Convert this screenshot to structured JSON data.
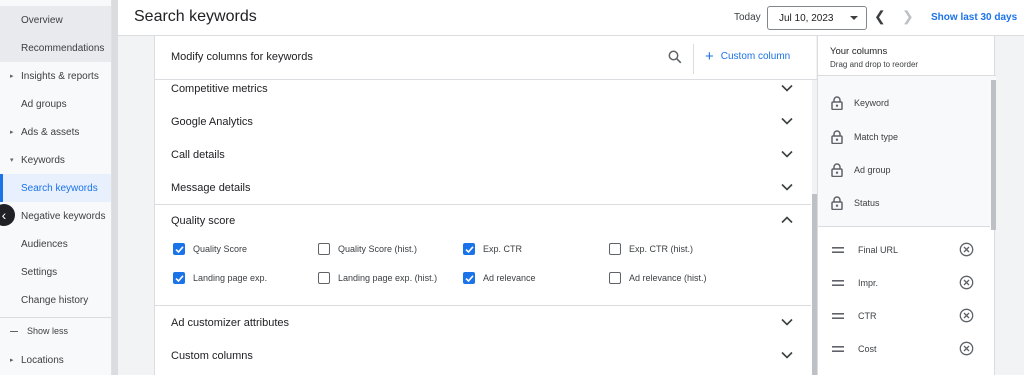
{
  "nav": {
    "items": [
      {
        "label": "Overview",
        "expandable": false
      },
      {
        "label": "Recommendations",
        "expandable": false
      },
      {
        "label": "Insights & reports",
        "expandable": true,
        "caret": "▸"
      },
      {
        "label": "Ad groups",
        "expandable": false
      },
      {
        "label": "Ads & assets",
        "expandable": true,
        "caret": "▸"
      },
      {
        "label": "Keywords",
        "expandable": true,
        "caret": "▾"
      },
      {
        "label": "Search keywords",
        "expandable": false
      },
      {
        "label": "Negative keywords",
        "expandable": false
      },
      {
        "label": "Audiences",
        "expandable": false
      },
      {
        "label": "Settings",
        "expandable": false
      },
      {
        "label": "Change history",
        "expandable": false
      }
    ],
    "show_less": "Show less",
    "locations": {
      "label": "Locations",
      "caret": "▸"
    },
    "collapse_icon": "chevron-left-icon"
  },
  "header": {
    "title": "Search keywords",
    "today_label": "Today",
    "date_value": "Jul 10, 2023",
    "show_last": "Show last 30 days"
  },
  "panel": {
    "title": "Modify columns for keywords",
    "custom_column_label": "Custom column",
    "sections": [
      {
        "label": "Competitive metrics",
        "expanded": false
      },
      {
        "label": "Google Analytics",
        "expanded": false
      },
      {
        "label": "Call details",
        "expanded": false
      },
      {
        "label": "Message details",
        "expanded": false
      },
      {
        "label": "Quality score",
        "expanded": true
      },
      {
        "label": "Ad customizer attributes",
        "expanded": false
      },
      {
        "label": "Custom columns",
        "expanded": false
      }
    ],
    "quality_score_options": [
      {
        "label": "Quality Score",
        "checked": true
      },
      {
        "label": "Quality Score (hist.)",
        "checked": false
      },
      {
        "label": "Exp. CTR",
        "checked": true
      },
      {
        "label": "Exp. CTR (hist.)",
        "checked": false
      },
      {
        "label": "Landing page exp.",
        "checked": true
      },
      {
        "label": "Landing page exp. (hist.)",
        "checked": false
      },
      {
        "label": "Ad relevance",
        "checked": true
      },
      {
        "label": "Ad relevance (hist.)",
        "checked": false
      }
    ]
  },
  "your_columns": {
    "title": "Your columns",
    "subtitle": "Drag and drop to reorder",
    "locked": [
      "Keyword",
      "Match type",
      "Ad group",
      "Status"
    ],
    "movable": [
      "Final URL",
      "Impr.",
      "CTR",
      "Cost"
    ]
  },
  "colors": {
    "accent": "#1a73e8",
    "nav_bg": "#f8f9fa",
    "selected_bg": "#e8f0fe"
  }
}
